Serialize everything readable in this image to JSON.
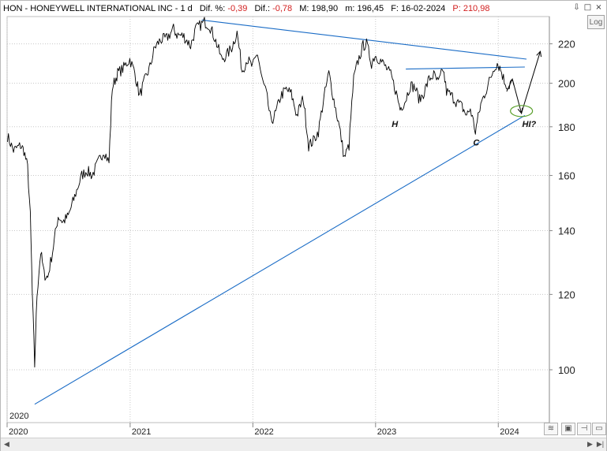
{
  "header": {
    "symbol": "HON - HONEYWELL INTERNATIONAL INC - 1 d",
    "dif_pct_label": "Dif. %:",
    "dif_pct_value": "-0,39",
    "dif_label": "Dif.:",
    "dif_value": "-0,78",
    "max_label": "M: 198,90",
    "min_label": "m: 196,45",
    "date_label": "F: 16-02-2024",
    "price_label": "P: 210,98"
  },
  "log_button": "Log",
  "window_buttons": [
    "⇩",
    "□",
    "×"
  ],
  "chart_data": {
    "type": "line",
    "title": "",
    "xlabel": "",
    "ylabel": "",
    "y_scale": "log",
    "ylim": [
      88,
      235
    ],
    "xlim": [
      "2020-01-01",
      "2024-06-01"
    ],
    "grid": true,
    "year_corner_label": "2020",
    "x_ticks": [
      {
        "date": "2020-01-01",
        "label": "2020"
      },
      {
        "date": "2021-01-01",
        "label": "2021"
      },
      {
        "date": "2022-01-01",
        "label": "2022"
      },
      {
        "date": "2023-01-01",
        "label": "2023"
      },
      {
        "date": "2024-01-01",
        "label": "2024"
      }
    ],
    "y_ticks": [
      100,
      120,
      140,
      160,
      180,
      200,
      220
    ],
    "series": [
      {
        "color": "#000000",
        "points": [
          [
            "2020-01-02",
            176
          ],
          [
            "2020-01-20",
            170
          ],
          [
            "2020-02-10",
            172
          ],
          [
            "2020-02-20",
            170
          ],
          [
            "2020-03-02",
            163
          ],
          [
            "2020-03-10",
            145
          ],
          [
            "2020-03-16",
            120
          ],
          [
            "2020-03-23",
            101
          ],
          [
            "2020-03-30",
            120
          ],
          [
            "2020-04-10",
            133
          ],
          [
            "2020-04-20",
            126
          ],
          [
            "2020-05-01",
            125
          ],
          [
            "2020-05-15",
            133
          ],
          [
            "2020-06-01",
            145
          ],
          [
            "2020-06-15",
            143
          ],
          [
            "2020-07-01",
            145
          ],
          [
            "2020-07-20",
            152
          ],
          [
            "2020-08-10",
            160
          ],
          [
            "2020-08-25",
            162
          ],
          [
            "2020-09-10",
            160
          ],
          [
            "2020-10-01",
            166
          ],
          [
            "2020-10-15",
            170
          ],
          [
            "2020-10-30",
            165
          ],
          [
            "2020-11-09",
            198
          ],
          [
            "2020-11-25",
            205
          ],
          [
            "2020-12-10",
            207
          ],
          [
            "2020-12-31",
            212
          ],
          [
            "2021-01-15",
            205
          ],
          [
            "2021-01-29",
            194
          ],
          [
            "2021-02-15",
            202
          ],
          [
            "2021-03-01",
            208
          ],
          [
            "2021-03-15",
            218
          ],
          [
            "2021-04-01",
            222
          ],
          [
            "2021-04-20",
            223
          ],
          [
            "2021-05-10",
            228
          ],
          [
            "2021-05-20",
            225
          ],
          [
            "2021-06-10",
            224
          ],
          [
            "2021-06-30",
            219
          ],
          [
            "2021-07-15",
            228
          ],
          [
            "2021-08-10",
            232
          ],
          [
            "2021-08-25",
            230
          ],
          [
            "2021-09-10",
            223
          ],
          [
            "2021-09-30",
            212
          ],
          [
            "2021-10-15",
            214
          ],
          [
            "2021-10-30",
            218
          ],
          [
            "2021-11-15",
            226
          ],
          [
            "2021-11-30",
            206
          ],
          [
            "2021-12-15",
            212
          ],
          [
            "2021-12-31",
            208
          ],
          [
            "2022-01-15",
            215
          ],
          [
            "2022-01-28",
            202
          ],
          [
            "2022-02-10",
            195
          ],
          [
            "2022-02-24",
            182
          ],
          [
            "2022-03-10",
            186
          ],
          [
            "2022-03-25",
            194
          ],
          [
            "2022-04-10",
            197
          ],
          [
            "2022-04-25",
            195
          ],
          [
            "2022-05-12",
            185
          ],
          [
            "2022-05-31",
            193
          ],
          [
            "2022-06-16",
            172
          ],
          [
            "2022-06-30",
            174
          ],
          [
            "2022-07-15",
            178
          ],
          [
            "2022-07-29",
            191
          ],
          [
            "2022-08-15",
            205
          ],
          [
            "2022-08-30",
            192
          ],
          [
            "2022-09-15",
            180
          ],
          [
            "2022-09-30",
            167
          ],
          [
            "2022-10-14",
            172
          ],
          [
            "2022-10-28",
            202
          ],
          [
            "2022-11-10",
            211
          ],
          [
            "2022-11-25",
            219
          ],
          [
            "2022-12-05",
            220
          ],
          [
            "2022-12-20",
            210
          ],
          [
            "2022-12-30",
            214
          ],
          [
            "2023-01-13",
            212
          ],
          [
            "2023-01-31",
            208
          ],
          [
            "2023-02-15",
            204
          ],
          [
            "2023-03-01",
            197
          ],
          [
            "2023-03-15",
            188
          ],
          [
            "2023-03-31",
            192
          ],
          [
            "2023-04-14",
            199
          ],
          [
            "2023-04-28",
            198
          ],
          [
            "2023-05-12",
            192
          ],
          [
            "2023-05-26",
            196
          ],
          [
            "2023-06-09",
            202
          ],
          [
            "2023-06-23",
            204
          ],
          [
            "2023-07-07",
            200
          ],
          [
            "2023-07-21",
            207
          ],
          [
            "2023-07-31",
            196
          ],
          [
            "2023-08-15",
            194
          ],
          [
            "2023-08-31",
            191
          ],
          [
            "2023-09-15",
            189
          ],
          [
            "2023-09-29",
            185
          ],
          [
            "2023-10-10",
            188
          ],
          [
            "2023-10-25",
            178
          ],
          [
            "2023-11-10",
            190
          ],
          [
            "2023-11-24",
            196
          ],
          [
            "2023-12-08",
            202
          ],
          [
            "2023-12-20",
            208
          ],
          [
            "2023-12-29",
            210
          ],
          [
            "2024-01-08",
            207
          ],
          [
            "2024-01-19",
            201
          ],
          [
            "2024-01-31",
            198
          ],
          [
            "2024-02-08",
            201
          ],
          [
            "2024-02-16",
            199
          ]
        ]
      }
    ],
    "trendlines": [
      {
        "color": "#1a6cc6",
        "from": [
          "2020-03-23",
          92
        ],
        "to": [
          "2024-03-20",
          185
        ]
      },
      {
        "color": "#1a6cc6",
        "from": [
          "2021-08-02",
          233
        ],
        "to": [
          "2024-03-25",
          212
        ]
      },
      {
        "color": "#1a6cc6",
        "from": [
          "2023-04-01",
          207
        ],
        "to": [
          "2024-03-20",
          208
        ]
      }
    ],
    "projection": {
      "color": "#000000",
      "points": [
        [
          "2024-01-26",
          196
        ],
        [
          "2024-02-12",
          202
        ],
        [
          "2024-03-10",
          186
        ],
        [
          "2024-05-05",
          216
        ]
      ]
    },
    "annotations": [
      {
        "text": "H",
        "at": [
          "2023-02-18",
          180
        ]
      },
      {
        "text": "C",
        "at": [
          "2023-10-18",
          172
        ]
      },
      {
        "text": "HI?",
        "at": [
          "2024-03-12",
          180
        ]
      }
    ],
    "ellipse": {
      "color": "#5aa02c",
      "at": [
        "2024-03-10",
        187
      ]
    },
    "last_price": 210.98
  }
}
